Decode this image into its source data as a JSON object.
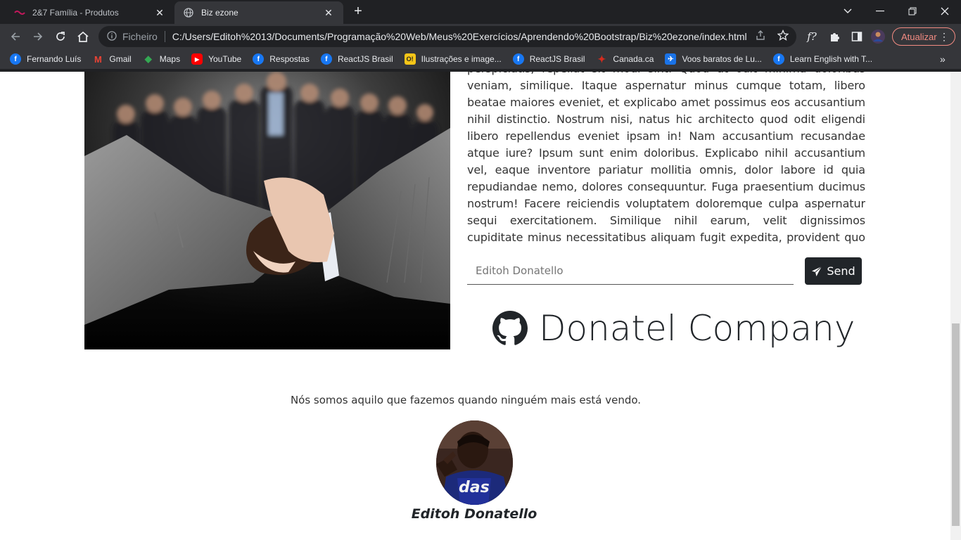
{
  "tabs": [
    {
      "title": "2&7 Família - Produtos",
      "active": false
    },
    {
      "title": "Biz ezone",
      "active": true
    }
  ],
  "toolbar": {
    "security_label": "Ficheiro",
    "url": "C:/Users/Editoh%2013/Documents/Programação%20Web/Meus%20Exercícios/Aprendendo%20Bootstrap/Biz%20ezone/index.html",
    "update_label": "Atualizar",
    "ext_label": "f?"
  },
  "bookmarks": [
    {
      "label": "Fernando Luís",
      "icon": "facebook-icon",
      "color": "#1877f2"
    },
    {
      "label": "Gmail",
      "icon": "gmail-icon",
      "color": "#ea4335"
    },
    {
      "label": "Maps",
      "icon": "maps-icon",
      "color": "#34a853"
    },
    {
      "label": "YouTube",
      "icon": "youtube-icon",
      "color": "#ff0000"
    },
    {
      "label": "Respostas",
      "icon": "facebook-icon",
      "color": "#1877f2"
    },
    {
      "label": "ReactJS Brasil",
      "icon": "facebook-icon",
      "color": "#1877f2"
    },
    {
      "label": "Ilustrações e image...",
      "icon": "illustrations-icon",
      "color": "#f5c518"
    },
    {
      "label": "ReactJS Brasil",
      "icon": "facebook-icon",
      "color": "#1877f2"
    },
    {
      "label": "Canada.ca",
      "icon": "maple-leaf-icon",
      "color": "#d52b1e"
    },
    {
      "label": "Voos baratos de Lu...",
      "icon": "flights-icon",
      "color": "#1a73e8"
    },
    {
      "label": "Learn English with T...",
      "icon": "facebook-icon",
      "color": "#1877f2"
    }
  ],
  "page": {
    "paragraph": "perspiciatis, repellat sit modi sint. Quod ut odit minima doloribus veniam, similique. Itaque aspernatur minus cumque totam, libero beatae maiores eveniet, et explicabo amet possimus eos accusantium nihil distinctio. Nostrum nisi, natus hic architecto quod odit eligendi libero repellendus eveniet ipsam in! Nam accusantium recusandae atque iure? Ipsum sunt enim doloribus. Explicabo nihil accusantium vel, eaque inventore pariatur mollitia omnis, dolor labore id quia repudiandae nemo, dolores consequuntur. Fuga praesentium ducimus nostrum! Facere reiciendis voluptatem doloremque culpa aspernatur sequi exercitationem. Similique nihil earum, velit dignissimos cupiditate minus necessitatibus aliquam fugit expedita, provident quo quisquam deleniti repellat sunt molestiae blanditiis illum explicabo excepturi.",
    "name_placeholder": "Editoh Donatello",
    "send_label": "Send",
    "company_name": "Donatel Company",
    "quote": "Nós somos aquilo que fazemos quando ninguém mais está vendo.",
    "author": "Editoh Donatello"
  },
  "colors": {
    "browser_dark": "#202124",
    "browser_toolbar": "#35363a",
    "send_button": "#212529",
    "update_accent": "#f28b82"
  }
}
